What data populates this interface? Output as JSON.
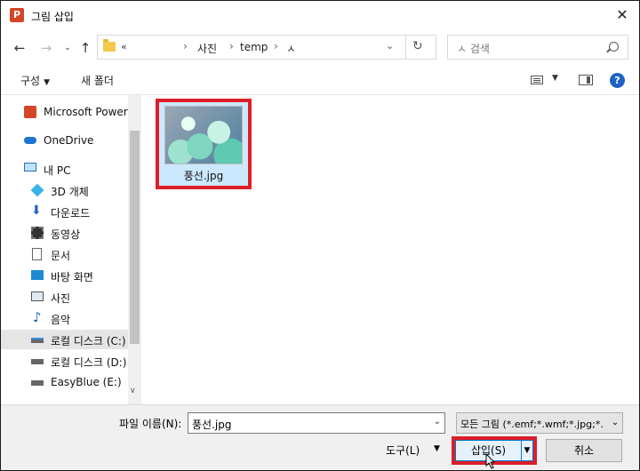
{
  "dialog": {
    "title": "그림 삽입",
    "app_icon_letter": "P"
  },
  "address": {
    "more": "«",
    "crumbs": [
      "사진",
      "temp",
      "ㅅ"
    ],
    "separator": "›"
  },
  "search": {
    "placeholder": "ㅅ 검색"
  },
  "toolbar": {
    "organize": "구성",
    "new_folder": "새 폴더",
    "help": "?"
  },
  "nav": {
    "items": [
      {
        "label": "Microsoft PowerP",
        "icon": "powerpoint-icon"
      },
      {
        "label": "OneDrive",
        "icon": "cloud-icon"
      },
      {
        "label": "내 PC",
        "icon": "computer-icon"
      },
      {
        "label": "3D 개체",
        "icon": "cube-icon"
      },
      {
        "label": "다운로드",
        "icon": "download-icon"
      },
      {
        "label": "동영상",
        "icon": "video-icon"
      },
      {
        "label": "문서",
        "icon": "document-icon"
      },
      {
        "label": "바탕 화면",
        "icon": "desktop-icon"
      },
      {
        "label": "사진",
        "icon": "picture-icon"
      },
      {
        "label": "음악",
        "icon": "music-icon"
      },
      {
        "label": "로컬 디스크 (C:)",
        "icon": "drive-icon",
        "selected": true
      },
      {
        "label": "로컬 디스크 (D:)",
        "icon": "drive-icon"
      },
      {
        "label": "EasyBlue (E:)",
        "icon": "drive-icon"
      }
    ]
  },
  "files": [
    {
      "name": "풍선.jpg",
      "selected": true
    }
  ],
  "bottom": {
    "filename_label": "파일 이름(N):",
    "filename_value": "풍선.jpg",
    "filter_value": "모든 그림 (*.emf;*.wmf;*.jpg;*.",
    "tools_label": "도구(L)",
    "insert_label": "삽입(S)",
    "cancel_label": "취소"
  },
  "colors": {
    "highlight": "#dc1e28",
    "selection": "#cce8ff",
    "accent": "#0078d7"
  }
}
